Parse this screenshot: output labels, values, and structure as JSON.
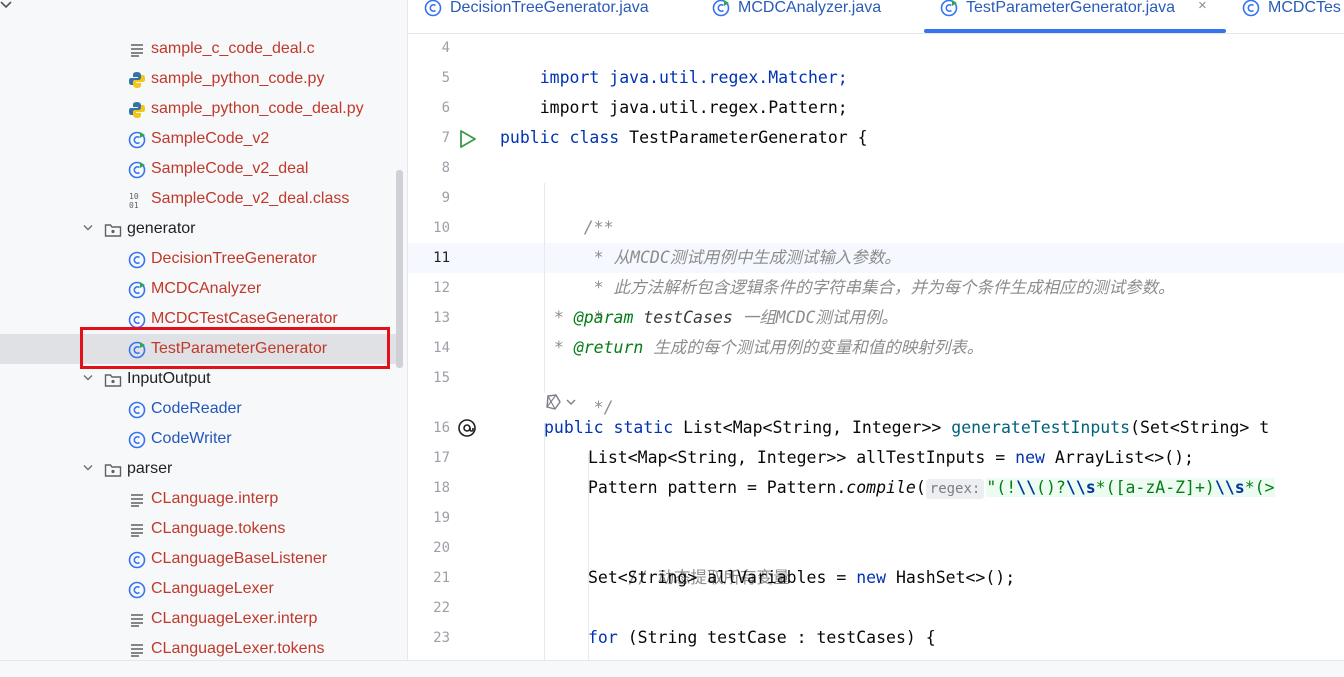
{
  "sidebar": {
    "items": [
      {
        "label": "sample_c_code_deal.c",
        "icon": "text-file-icon"
      },
      {
        "label": "sample_python_code.py",
        "icon": "python-file-icon"
      },
      {
        "label": "sample_python_code_deal.py",
        "icon": "python-file-icon"
      },
      {
        "label": "SampleCode_v2",
        "icon": "runnable-class-icon"
      },
      {
        "label": "SampleCode_v2_deal",
        "icon": "runnable-class-icon"
      },
      {
        "label": "SampleCode_v2_deal.class",
        "icon": "binary-class-file-icon"
      },
      {
        "label": "generator",
        "icon": "folder-icon"
      },
      {
        "label": "DecisionTreeGenerator",
        "icon": "class-icon"
      },
      {
        "label": "MCDCAnalyzer",
        "icon": "runnable-class-icon"
      },
      {
        "label": "MCDCTestCaseGenerator",
        "icon": "class-icon"
      },
      {
        "label": "TestParameterGenerator",
        "icon": "runnable-class-icon"
      },
      {
        "label": "InputOutput",
        "icon": "folder-icon"
      },
      {
        "label": "CodeReader",
        "icon": "class-icon"
      },
      {
        "label": "CodeWriter",
        "icon": "class-icon"
      },
      {
        "label": "parser",
        "icon": "folder-icon"
      },
      {
        "label": "CLanguage.interp",
        "icon": "text-file-icon"
      },
      {
        "label": "CLanguage.tokens",
        "icon": "text-file-icon"
      },
      {
        "label": "CLanguageBaseListener",
        "icon": "class-icon"
      },
      {
        "label": "CLanguageLexer",
        "icon": "class-icon"
      },
      {
        "label": "CLanguageLexer.interp",
        "icon": "text-file-icon"
      },
      {
        "label": "CLanguageLexer.tokens",
        "icon": "text-file-icon"
      }
    ]
  },
  "tabs": [
    {
      "label": "DecisionTreeGenerator.java",
      "active": false
    },
    {
      "label": "MCDCAnalyzer.java",
      "active": false
    },
    {
      "label": "TestParameterGenerator.java",
      "active": true
    },
    {
      "label": "MCDCTes",
      "active": false
    }
  ],
  "tab_close": "×",
  "editor": {
    "current_line": 11,
    "line_numbers": [
      "4",
      "5",
      "6",
      "7",
      "8",
      "9",
      "10",
      "11",
      "12",
      "13",
      "14",
      "15",
      "16",
      "17",
      "18",
      "19",
      "20",
      "21",
      "22",
      "23"
    ],
    "code": {
      "l4": "import java.util.regex.Matcher;",
      "l5": "import java.util.regex.Pattern;",
      "l7_kw": "public class",
      "l7_rest": " TestParameterGenerator {",
      "l9": "/**",
      "l10": " * 从MCDC测试用例中生成测试输入参数。",
      "l11": " * 此方法解析包含逻辑条件的字符串集合，并为每个条件生成相应的测试参数。",
      "l12": " *",
      "l13_star": " * ",
      "l13_tag": "@param",
      "l13_name": " testCases",
      "l13_desc": " 一组MCDC测试用例。",
      "l14_star": " * ",
      "l14_tag": "@return",
      "l14_desc": " 生成的每个测试用例的变量和值的映射列表。",
      "l15": " */",
      "l16_kw": "public static",
      "l16_type": " List<Map<String, Integer>> ",
      "l16_fn": "generateTestInputs",
      "l16_rest": "(Set<String> t",
      "l17_type": "List<Map<String, Integer>> allTestInputs = ",
      "l17_kw": "new",
      "l17_rest": " ArrayList<>();",
      "l18_a": "Pattern pattern = Pattern.",
      "l18_method": "compile",
      "l18_paren": "(",
      "l18_hint": "regex:",
      "l18_str1": "\"(!",
      "l18_esc1": "\\\\",
      "l18_str2": "(",
      "l18_str3": ")?",
      "l18_esc2": "\\\\s",
      "l18_str4": "*([a-zA-Z]+)",
      "l18_esc3": "\\\\s",
      "l18_str5": "*(>",
      "l20": "// 动态提取所有变量",
      "l21_a": "Set<String> allVariables = ",
      "l21_kw": "new",
      "l21_rest": " HashSet<>();",
      "l23_kw": "for",
      "l23_rest": " (String testCase : testCases) {"
    }
  },
  "colors": {
    "keyword": "#0033b3",
    "function": "#00627a",
    "doc_comment": "#8c8c8c",
    "doc_tag": "#067d17",
    "string": "#067d17",
    "file_red": "#c0392b",
    "class_blue": "#2257b8",
    "highlight_box": "#e3101a",
    "active_tab_underline": "#3574f0"
  }
}
